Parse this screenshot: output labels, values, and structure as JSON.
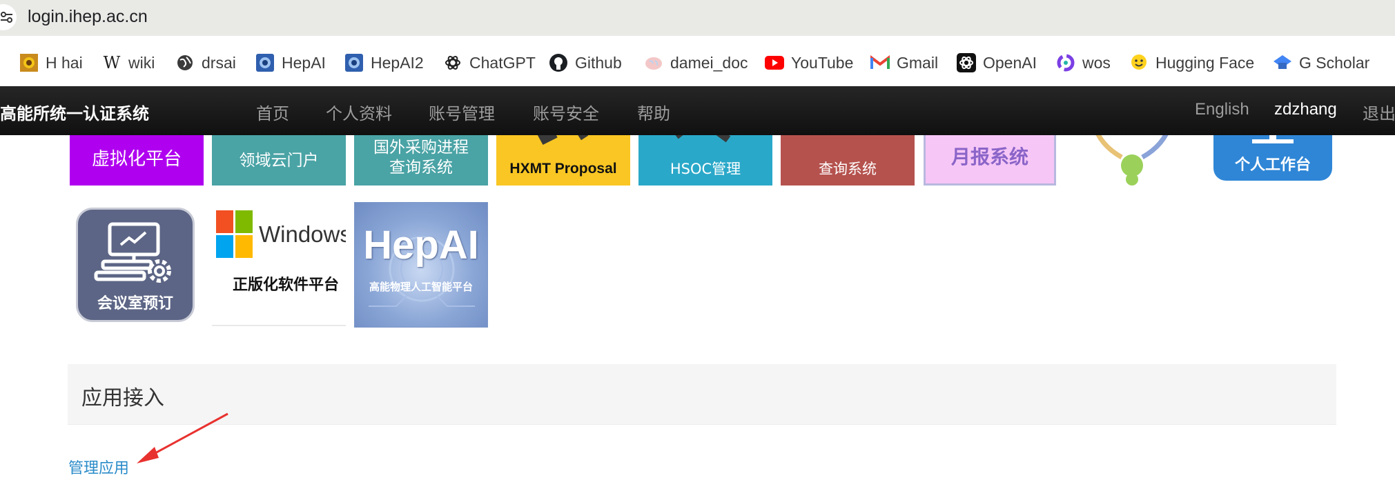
{
  "browser": {
    "url": "login.ihep.ac.cn",
    "bookmarks": [
      {
        "label": "H hai",
        "icon": "sunflower-icon"
      },
      {
        "label": "wiki",
        "icon": "wikipedia-icon"
      },
      {
        "label": "drsai",
        "icon": "globe-icon"
      },
      {
        "label": "HepAI",
        "icon": "hepai-icon"
      },
      {
        "label": "HepAI2",
        "icon": "hepai-icon"
      },
      {
        "label": "ChatGPT",
        "icon": "openai-icon"
      },
      {
        "label": "Github",
        "icon": "github-icon"
      },
      {
        "label": "damei_doc",
        "icon": "brain-icon"
      },
      {
        "label": "YouTube",
        "icon": "youtube-icon"
      },
      {
        "label": "Gmail",
        "icon": "gmail-icon"
      },
      {
        "label": "OpenAI",
        "icon": "openai-icon"
      },
      {
        "label": "wos",
        "icon": "wos-icon"
      },
      {
        "label": "Hugging Face",
        "icon": "hugging-face-icon"
      },
      {
        "label": "G Scholar",
        "icon": "scholar-icon"
      }
    ]
  },
  "navbar": {
    "brand": "高能所统一认证系统",
    "items": [
      "首页",
      "个人资料",
      "账号管理",
      "账号安全",
      "帮助"
    ],
    "language": "English",
    "username": "zdzhang",
    "logout": "退出"
  },
  "tiles": [
    {
      "label": "虚拟化平台",
      "color": "#b000f0"
    },
    {
      "label": "领域云门户",
      "color": "#4aa3a5"
    },
    {
      "line1": "国外采购进程",
      "line2": "查询系统",
      "color": "#4aa3a5"
    },
    {
      "label": "HXMT Proposal",
      "color": "#f9c623"
    },
    {
      "label": "HSOC管理",
      "color": "#2aa8c9"
    },
    {
      "label": "查询系统",
      "color": "#b5524e"
    },
    {
      "label": "月报系统",
      "color": "#f6c6f6"
    },
    {
      "label": "",
      "color": "#9bd15a"
    },
    {
      "label": "个人工作台",
      "color": "#2f86d6"
    },
    {
      "label": "会议室预订",
      "color": "#5c6585"
    },
    {
      "title": "Windows",
      "subtitle": "正版化软件平台"
    },
    {
      "title": "HepAI",
      "subtitle": "高能物理人工智能平台",
      "color": "#8aa6d6"
    }
  ],
  "panel": {
    "title": "应用接入",
    "link": "管理应用",
    "arrow_color": "#e8322f"
  }
}
